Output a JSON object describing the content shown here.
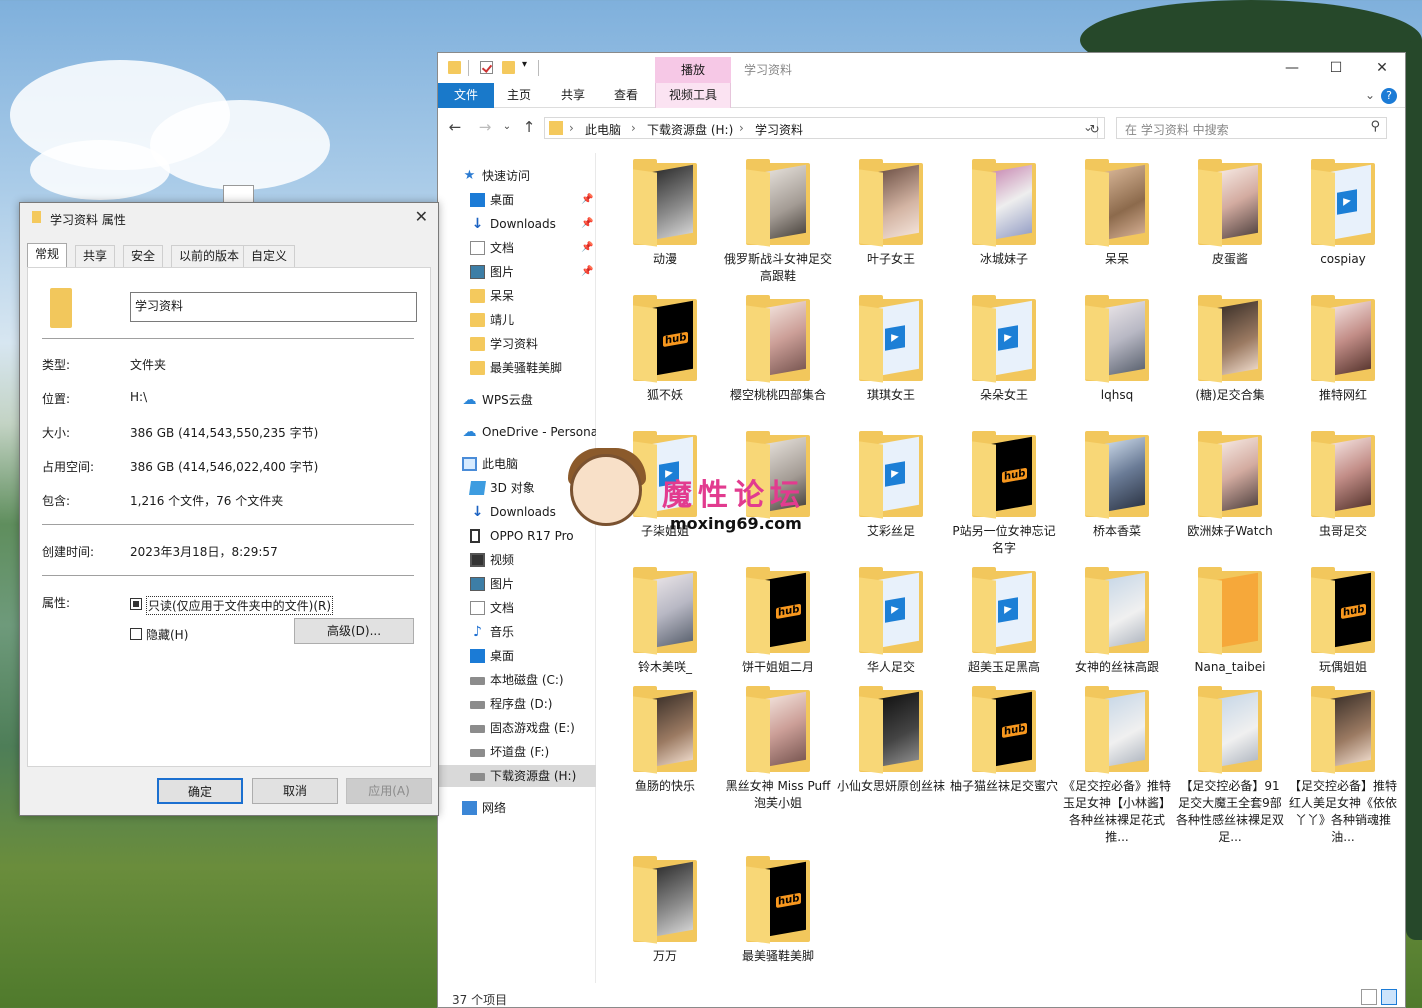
{
  "explorer": {
    "window_title": "学习资料",
    "context_tab": "播放",
    "ribbon_tabs": [
      "文件",
      "主页",
      "共享",
      "查看",
      "视频工具"
    ],
    "breadcrumb": [
      "此电脑",
      "下载资源盘 (H:)",
      "学习资料"
    ],
    "search_placeholder": "在 学习资料 中搜索",
    "nav": [
      {
        "label": "快速访问",
        "icon": "star-icon",
        "indent": 0,
        "pinned": false
      },
      {
        "label": "桌面",
        "icon": "desktop-icon",
        "indent": 1,
        "pinned": true
      },
      {
        "label": "Downloads",
        "icon": "download-icon",
        "indent": 1,
        "pinned": true
      },
      {
        "label": "文档",
        "icon": "document-icon",
        "indent": 1,
        "pinned": true
      },
      {
        "label": "图片",
        "icon": "pictures-icon",
        "indent": 1,
        "pinned": true
      },
      {
        "label": "呆呆",
        "icon": "folder-icon",
        "indent": 1,
        "pinned": false
      },
      {
        "label": "靖儿",
        "icon": "folder-icon",
        "indent": 1,
        "pinned": false
      },
      {
        "label": "学习资料",
        "icon": "folder-icon",
        "indent": 1,
        "pinned": false
      },
      {
        "label": "最美骚鞋美脚",
        "icon": "folder-icon",
        "indent": 1,
        "pinned": false
      },
      {
        "label": "WPS云盘",
        "icon": "cloud-icon",
        "indent": 0,
        "pinned": false
      },
      {
        "label": "OneDrive - Persona",
        "icon": "onedrive-icon",
        "indent": 0,
        "pinned": false
      },
      {
        "label": "此电脑",
        "icon": "computer-icon",
        "indent": 0,
        "pinned": false
      },
      {
        "label": "3D 对象",
        "icon": "cube-icon",
        "indent": 1,
        "pinned": false
      },
      {
        "label": "Downloads",
        "icon": "download-icon",
        "indent": 1,
        "pinned": false
      },
      {
        "label": "OPPO R17 Pro",
        "icon": "phone-icon",
        "indent": 1,
        "pinned": false
      },
      {
        "label": "视频",
        "icon": "video-icon",
        "indent": 1,
        "pinned": false
      },
      {
        "label": "图片",
        "icon": "pictures-icon",
        "indent": 1,
        "pinned": false
      },
      {
        "label": "文档",
        "icon": "document-icon",
        "indent": 1,
        "pinned": false
      },
      {
        "label": "音乐",
        "icon": "music-icon",
        "indent": 1,
        "pinned": false
      },
      {
        "label": "桌面",
        "icon": "desktop-icon",
        "indent": 1,
        "pinned": false
      },
      {
        "label": "本地磁盘 (C:)",
        "icon": "drive-icon",
        "indent": 1,
        "pinned": false
      },
      {
        "label": "程序盘 (D:)",
        "icon": "drive-icon",
        "indent": 1,
        "pinned": false
      },
      {
        "label": "固态游戏盘 (E:)",
        "icon": "drive-icon",
        "indent": 1,
        "pinned": false
      },
      {
        "label": "坏道盘 (F:)",
        "icon": "drive-icon",
        "indent": 1,
        "pinned": false
      },
      {
        "label": "下载资源盘 (H:)",
        "icon": "drive-icon",
        "indent": 1,
        "pinned": false,
        "selected": true
      },
      {
        "label": "网络",
        "icon": "network-icon",
        "indent": 0,
        "pinned": false
      }
    ],
    "items": [
      {
        "name": "动漫",
        "thumb": "p1"
      },
      {
        "name": "俄罗斯战斗女神足交高跟鞋",
        "thumb": "p2"
      },
      {
        "name": "叶子女王",
        "thumb": "p3"
      },
      {
        "name": "冰城妹子",
        "thumb": "p4"
      },
      {
        "name": "呆呆",
        "thumb": "p5"
      },
      {
        "name": "皮蛋酱",
        "thumb": "p6"
      },
      {
        "name": "cospiay",
        "thumb": "vid"
      },
      {
        "name": "狐不妖",
        "thumb": "hub"
      },
      {
        "name": "樱空桃桃四部集合",
        "thumb": "p8"
      },
      {
        "name": "琪琪女王",
        "thumb": "vid"
      },
      {
        "name": "朵朵女王",
        "thumb": "vid"
      },
      {
        "name": "lqhsq",
        "thumb": "p9"
      },
      {
        "name": "(糖)足交合集",
        "thumb": "dk"
      },
      {
        "name": "推特网红",
        "thumb": "p11"
      },
      {
        "name": "子柒姐姐",
        "thumb": "vid"
      },
      {
        "name": "",
        "thumb": "p2"
      },
      {
        "name": "艾彩丝足",
        "thumb": "vid"
      },
      {
        "name": "P站另一位女神忘记名字",
        "thumb": "hub"
      },
      {
        "name": "桥本香菜",
        "thumb": "p10"
      },
      {
        "name": "欧洲妹子Watch",
        "thumb": "p6"
      },
      {
        "name": "虫哥足交",
        "thumb": "p11"
      },
      {
        "name": "铃木美咲_",
        "thumb": "p9"
      },
      {
        "name": "饼干姐姐二月",
        "thumb": "hub"
      },
      {
        "name": "华人足交",
        "thumb": "vid"
      },
      {
        "name": "超美玉足黑高",
        "thumb": "vid"
      },
      {
        "name": "女神的丝袜高跟",
        "thumb": "p7"
      },
      {
        "name": "Nana_taibei",
        "thumb": "org"
      },
      {
        "name": "玩偶姐姐",
        "thumb": "hub"
      },
      {
        "name": "鱼肠的快乐",
        "thumb": "dk"
      },
      {
        "name": "黑丝女神 Miss Puff 泡芙小姐",
        "thumb": "p8"
      },
      {
        "name": "小仙女思妍原创丝袜",
        "thumb": "blk"
      },
      {
        "name": "柚子猫丝袜足交蜜穴",
        "thumb": "hub"
      },
      {
        "name": "《足交控必备》推特玉足女神【小林酱】各种丝袜裸足花式推...",
        "thumb": "p7"
      },
      {
        "name": "【足交控必备】91足交大魔王全套9部 各种性感丝袜裸足双足...",
        "thumb": "p7"
      },
      {
        "name": "【足交控必备】推特红人美足女神《依依丫丫》各种销魂推油...",
        "thumb": "dk"
      },
      {
        "name": "万万",
        "thumb": "p1"
      },
      {
        "name": "最美骚鞋美脚",
        "thumb": "hub"
      }
    ],
    "status": "37 个项目"
  },
  "watermark": {
    "title": "魔性论坛",
    "url": "moxing69.com"
  },
  "dialog": {
    "title": "学习资料 属性",
    "tabs": [
      "常规",
      "共享",
      "安全",
      "以前的版本",
      "自定义"
    ],
    "name": "学习资料",
    "rows1": [
      {
        "label": "类型:",
        "value": "文件夹"
      },
      {
        "label": "位置:",
        "value": "H:\\"
      },
      {
        "label": "大小:",
        "value": "386 GB (414,543,550,235 字节)"
      },
      {
        "label": "占用空间:",
        "value": "386 GB (414,546,022,400 字节)"
      },
      {
        "label": "包含:",
        "value": "1,216 个文件，76 个文件夹"
      }
    ],
    "created_label": "创建时间:",
    "created_value": "2023年3月18日，8:29:57",
    "attr_label": "属性:",
    "readonly_label": "只读(仅应用于文件夹中的文件)(R)",
    "hidden_label": "隐藏(H)",
    "advanced_label": "高级(D)...",
    "ok_label": "确定",
    "cancel_label": "取消",
    "apply_label": "应用(A)"
  }
}
